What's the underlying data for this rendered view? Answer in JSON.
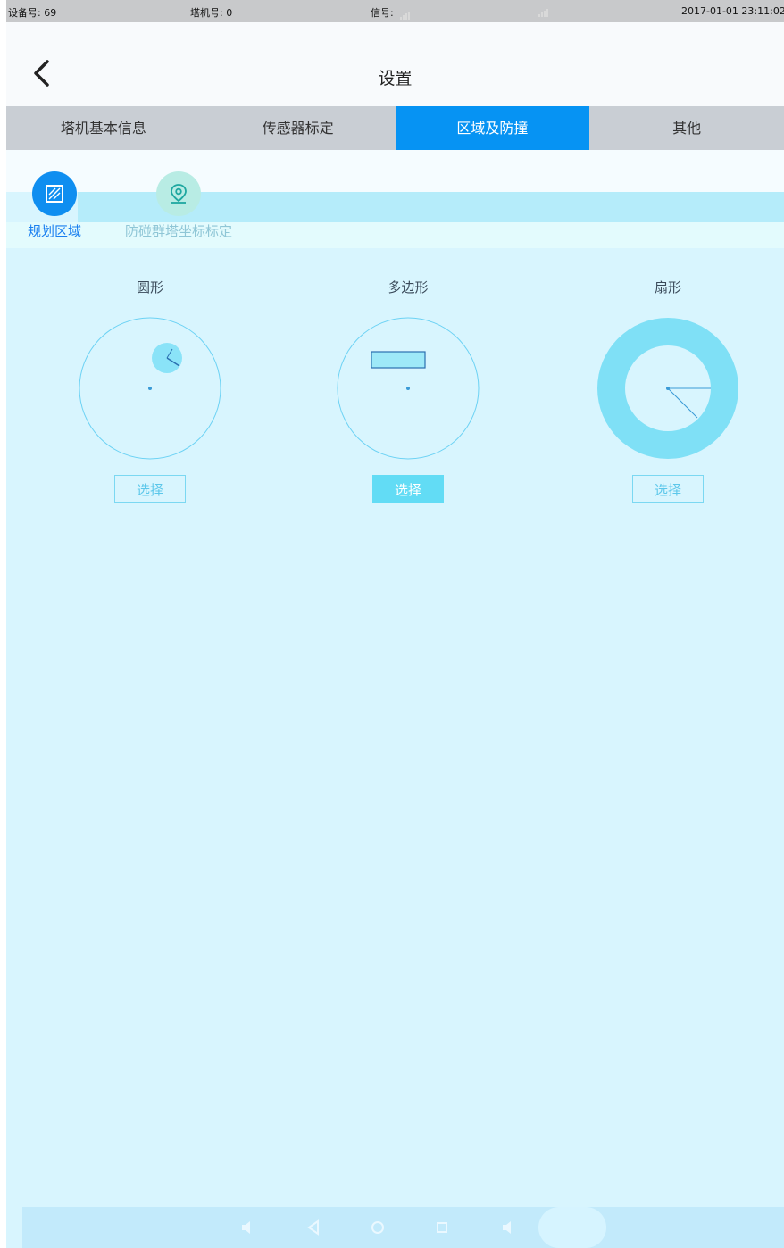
{
  "status_bar": {
    "device_label": "设备号: 69",
    "crane_label": "塔机号: 0",
    "signal_label": "信号:",
    "datetime": "2017-01-01 23:11:02"
  },
  "header": {
    "title": "设置"
  },
  "tabs": [
    {
      "label": "塔机基本信息",
      "active": false
    },
    {
      "label": "传感器标定",
      "active": false
    },
    {
      "label": "区域及防撞",
      "active": true
    },
    {
      "label": "其他",
      "active": false
    }
  ],
  "subnav": [
    {
      "label": "规划区域",
      "icon": "region-grid-icon",
      "active": true
    },
    {
      "label": "防碰群塔坐标标定",
      "icon": "location-pin-icon",
      "active": false
    }
  ],
  "shapes": [
    {
      "title": "圆形",
      "button": "选择",
      "selected": false
    },
    {
      "title": "多边形",
      "button": "选择",
      "selected": true
    },
    {
      "title": "扇形",
      "button": "选择",
      "selected": false
    }
  ],
  "colors": {
    "accent": "#0693f3",
    "background": "#d8f5fe",
    "tab_bar": "#c9ced4",
    "shape_outline": "#6cd2f4",
    "ring_fill": "#7fe0f6"
  }
}
